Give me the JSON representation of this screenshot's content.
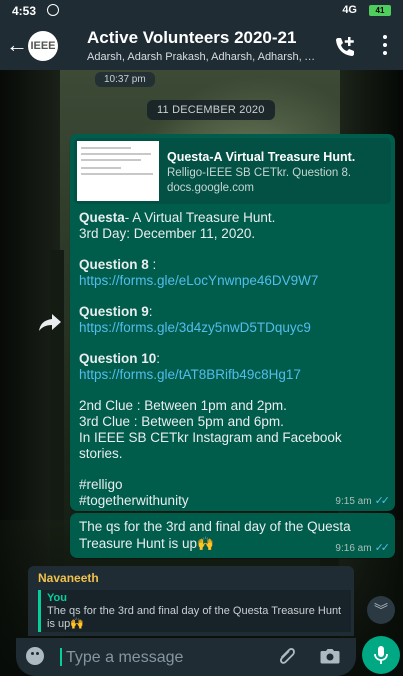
{
  "status_bar": {
    "time": "4:53",
    "network": "4G",
    "battery": "41"
  },
  "header": {
    "title": "Active Volunteers 2020-21",
    "subtitle": "Adarsh, Adarsh Prakash, Adharsh, Adharsh, Adh..."
  },
  "chat": {
    "prev_time": "10:37 pm",
    "date_chip": "11 DECEMBER 2020",
    "message1": {
      "preview_title": "Questa-A Virtual Treasure Hunt.",
      "preview_desc": "Relligo-IEEE SB CETkr. Question 8.",
      "preview_domain": "docs.google.com",
      "intro_bold": "Questa",
      "intro_rest": "- A Virtual Treasure Hunt.",
      "intro_line2": "3rd Day: December 11, 2020.",
      "q8_label": "Question 8",
      "q8_suffix": " :",
      "q8_link": "https://forms.gle/eLocYnwnpe46DV9W7",
      "q9_label": "Question 9",
      "q9_suffix": ":",
      "q9_link": "https://forms.gle/3d4zy5nwD5TDquyc9",
      "q10_label": "Question 10",
      "q10_suffix": ":",
      "q10_link": "https://forms.gle/tAT8BRifb49c8Hg17",
      "clue1": "2nd Clue : Between 1pm and 2pm.",
      "clue2": "3rd Clue : Between 5pm and 6pm.",
      "clue3": "In IEEE SB CETkr Instagram and Facebook",
      "clue4": "stories.",
      "tag1": "#relligo",
      "tag2": "#togetherwithunity",
      "time": "9:15 am",
      "ticks": "✓✓"
    },
    "message2": {
      "text": "The qs for the 3rd and final day of the Questa Treasure Hunt is up🙌",
      "time": "9:16 am",
      "ticks": "✓✓"
    }
  },
  "reply": {
    "sender": "Navaneeth",
    "quoted_author": "You",
    "quoted_text": "The qs for the 3rd and final day of the Questa Treasure Hunt is up🙌"
  },
  "input": {
    "placeholder": "Type a message"
  },
  "colors": {
    "header_bg": "#1f2c34",
    "outgoing_bubble": "#005c4b",
    "link": "#53bdeb",
    "accent": "#00a884",
    "sender_name": "#f0c14b"
  }
}
